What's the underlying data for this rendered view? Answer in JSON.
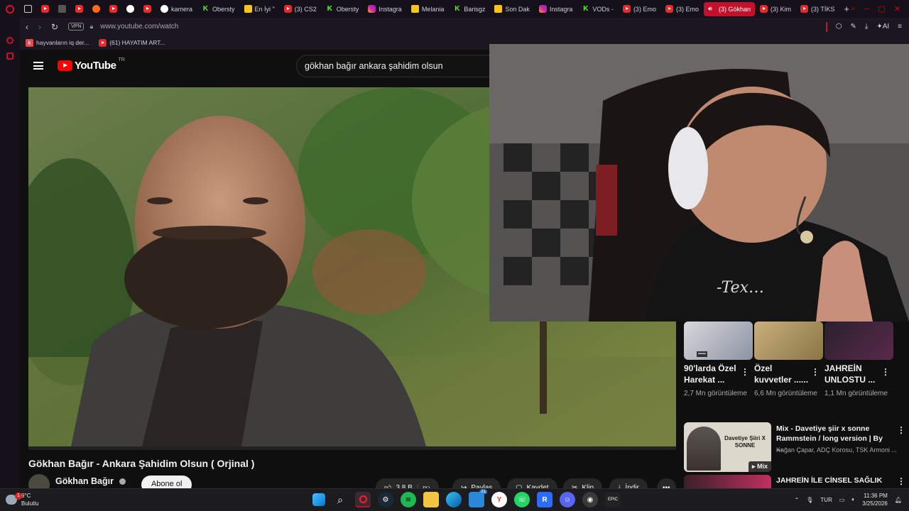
{
  "browser": {
    "tabs": [
      {
        "label": "",
        "icon": "image-icon"
      },
      {
        "label": "",
        "icon": "youtube-icon"
      },
      {
        "label": "",
        "icon": "generic-icon"
      },
      {
        "label": "",
        "icon": "youtube-icon"
      },
      {
        "label": "",
        "icon": "play-icon"
      },
      {
        "label": "",
        "icon": "youtube-icon"
      },
      {
        "label": "",
        "icon": "compass-icon"
      },
      {
        "label": "",
        "icon": "youtube-icon"
      },
      {
        "label": "kamera",
        "icon": "compass-icon"
      },
      {
        "label": "Obersty",
        "icon": "kick-icon"
      },
      {
        "label": "En İyi \"",
        "icon": "news-icon"
      },
      {
        "label": "(3) CS2",
        "icon": "youtube-icon"
      },
      {
        "label": "Obersty",
        "icon": "kick-icon"
      },
      {
        "label": "Instagra",
        "icon": "instagram-icon"
      },
      {
        "label": "Melania",
        "icon": "news-icon"
      },
      {
        "label": "Barisgz",
        "icon": "kick-icon"
      },
      {
        "label": "Son Dak",
        "icon": "news-icon"
      },
      {
        "label": "Instagra",
        "icon": "instagram-icon"
      },
      {
        "label": "VODs -",
        "icon": "kick-icon"
      },
      {
        "label": "(3) Emo",
        "icon": "youtube-icon"
      },
      {
        "label": "(3) Emo",
        "icon": "youtube-icon"
      },
      {
        "label": "(3) Gökhan",
        "icon": "speaker-icon",
        "active": true
      },
      {
        "label": "(3) Kim",
        "icon": "youtube-icon"
      },
      {
        "label": "(3) TİKS",
        "icon": "youtube-icon"
      }
    ],
    "vpn_label": "VPN",
    "url": "www.youtube.com/watch",
    "ai_label": "AI",
    "bookmarks": [
      {
        "label": "hayvanların iq der...",
        "icon": "k-icon"
      },
      {
        "label": "(61) HAYATIM ART...",
        "icon": "youtube-icon"
      }
    ]
  },
  "youtube": {
    "region": "TR",
    "search_query": "gökhan bağır ankara şahidim olsun",
    "video_title": "Gökhan Bağır - Ankara Şahidim Olsun ( Orjinal )",
    "channel_name": "Gökhan Bağır",
    "subscribe_label": "Abone ol",
    "actions": {
      "likes": "3,8 B",
      "share": "Paylaş",
      "save": "Kaydet",
      "clip": "Klip",
      "download": "İndir"
    },
    "shorts": [
      {
        "title": "90'larda Özel Harekat ...",
        "views": "2,7 Mn görüntüleme"
      },
      {
        "title": "Özel kuvvetler ......",
        "views": "6,6 Mn görüntüleme"
      },
      {
        "title": "JAHREİN UNLOSTU ...",
        "views": "1,1 Mn görüntüleme"
      }
    ],
    "mix": {
      "title": "Mix - Davetiye şiir x sonne Rammstein / long version | By ...",
      "subtitle": "Kağan Çapar, ADÇ Korosu, TSK Armoni ...",
      "badge": "Mix",
      "thumb_text": "Davetiye Şiiri X SONNE"
    },
    "next_title": "JAHREİN İLE CİNSEL SAĞLIK"
  },
  "taskbar": {
    "weather_temp": "9°C",
    "weather_desc": "Bulutlu",
    "weather_badge": "1",
    "notif_count": "21",
    "language": "TUR",
    "time": "11:36 PM",
    "date": "3/25/2026"
  },
  "colors": {
    "accent": "#c4102a",
    "youtube_red": "#ff0000",
    "background": "#0f0f0f"
  }
}
